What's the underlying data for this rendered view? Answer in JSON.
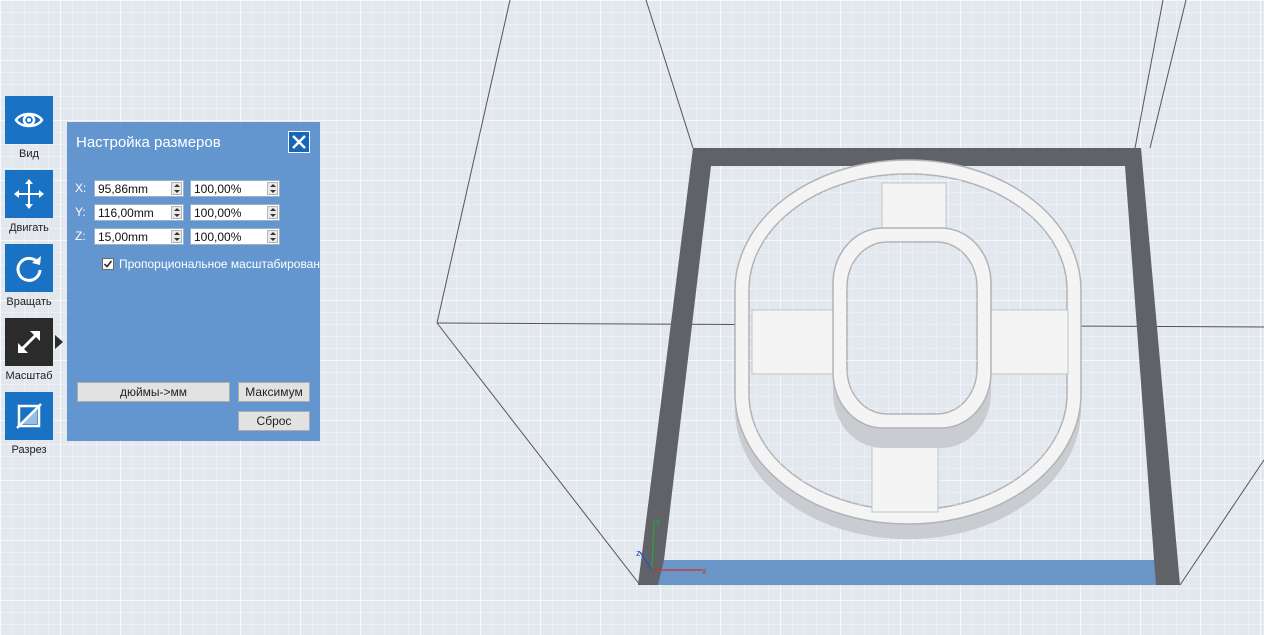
{
  "toolbar": {
    "items": [
      {
        "label": "Вид",
        "icon": "eye-icon"
      },
      {
        "label": "Двигать",
        "icon": "move-arrows-icon"
      },
      {
        "label": "Вращать",
        "icon": "rotate-icon"
      },
      {
        "label": "Масштаб",
        "icon": "scale-diagonal-arrow-icon",
        "active": true
      },
      {
        "label": "Разрез",
        "icon": "cut-section-icon"
      }
    ]
  },
  "scale_panel": {
    "title": "Настройка размеров",
    "rows": [
      {
        "axis": "X:",
        "size": "95,86mm",
        "percent": "100,00%"
      },
      {
        "axis": "Y:",
        "size": "116,00mm",
        "percent": "100,00%"
      },
      {
        "axis": "Z:",
        "size": "15,00mm",
        "percent": "100,00%"
      }
    ],
    "proportional_label": "Пропорциональное масштабирование",
    "proportional_checked": true,
    "inch_to_mm_label": "дюймы->мм",
    "max_label": "Максимум",
    "reset_label": "Сброс"
  },
  "axis_gizmo": {
    "x": "x",
    "y": "y",
    "z": "z"
  },
  "colors": {
    "toolbar_blue": "#1a72c4",
    "toolbar_active": "#2b2b2b",
    "panel_bg": "#598fcc",
    "grid_bg": "#e9edf2",
    "plate_frame": "#5f6368",
    "model_white": "#f4f4f4",
    "selection_blue": "#6a9bd2"
  }
}
